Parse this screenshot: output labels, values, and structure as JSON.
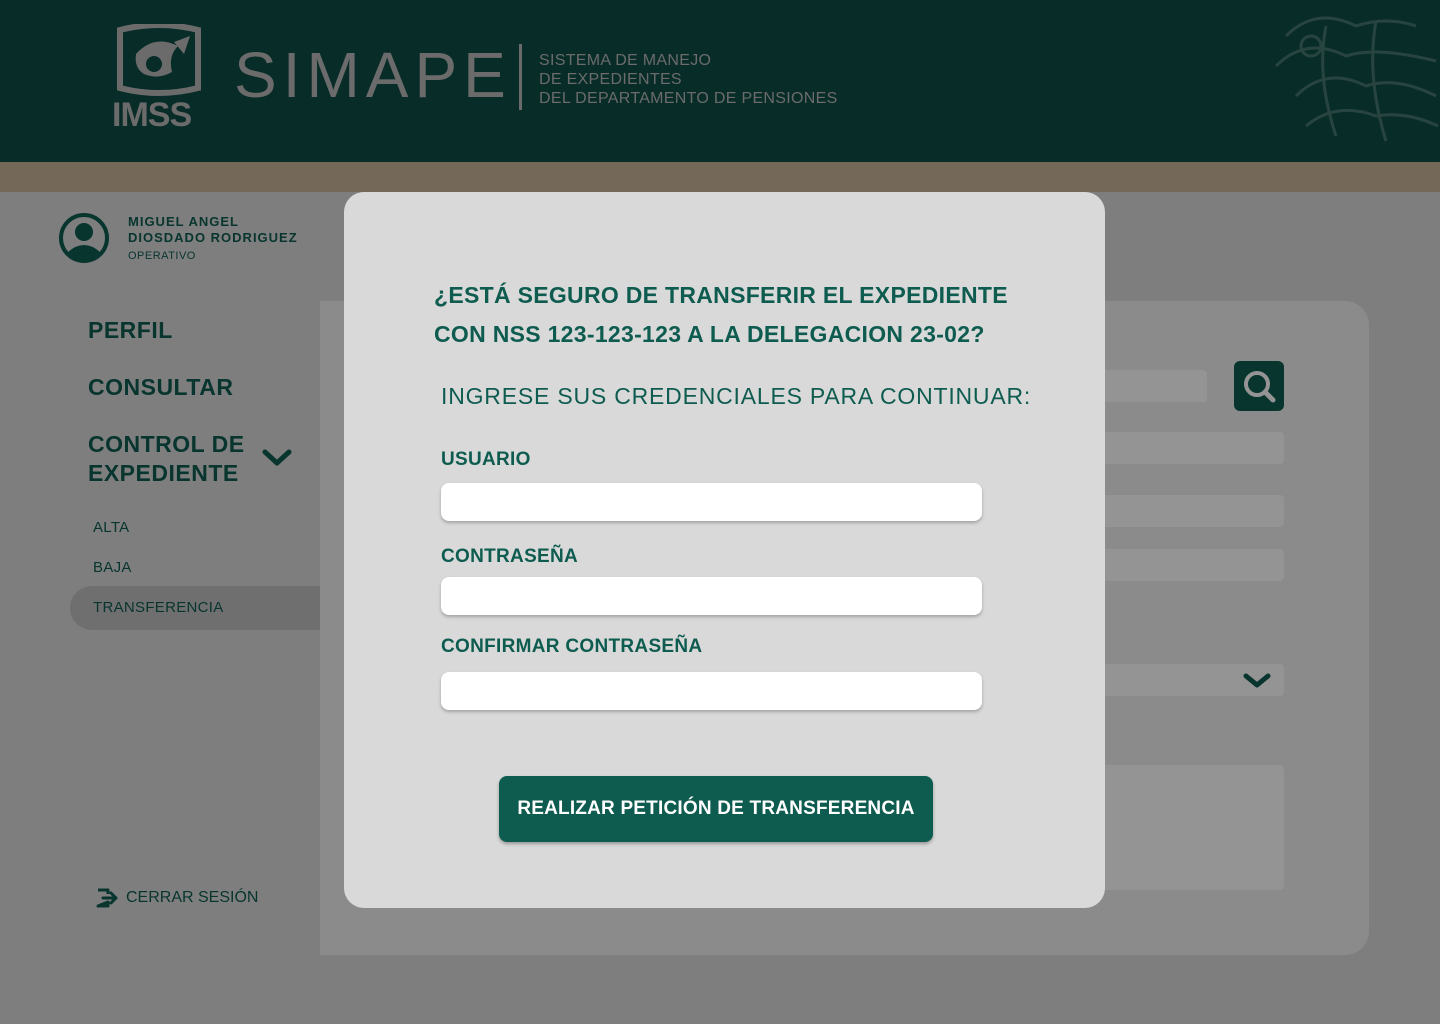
{
  "header": {
    "logo_text": "IMSS",
    "app_name": "SIMAPE",
    "subtitle_lines": [
      "SISTEMA DE MANEJO",
      "DE EXPEDIENTES",
      "DEL DEPARTAMENTO DE PENSIONES"
    ]
  },
  "user": {
    "name_line1": "MIGUEL ANGEL",
    "name_line2": "DIOSDADO RODRIGUEZ",
    "role": "OPERATIVO"
  },
  "sidebar": {
    "items": [
      {
        "label": "PERFIL"
      },
      {
        "label": "CONSULTAR"
      },
      {
        "label_line1": "CONTROL DE",
        "label_line2": "EXPEDIENTE"
      }
    ],
    "subitems": [
      {
        "label": "ALTA"
      },
      {
        "label": "BAJA"
      },
      {
        "label": "TRANSFERENCIA",
        "active": true
      }
    ],
    "logout_label": "CERRAR SESIÓN"
  },
  "modal": {
    "question_line1": "¿ESTÁ SEGURO DE TRANSFERIR EL EXPEDIENTE",
    "question_line2": "CON NSS 123-123-123 A LA DELEGACION 23-02?",
    "instruction": "INGRESE SUS CREDENCIALES PARA CONTINUAR:",
    "fields": [
      {
        "label": "USUARIO",
        "value": "",
        "placeholder": ""
      },
      {
        "label": "CONTRASEÑA",
        "value": "",
        "placeholder": ""
      },
      {
        "label": "CONFIRMAR CONTRASEÑA",
        "value": "",
        "placeholder": ""
      }
    ],
    "submit_label": "REALIZAR PETICIÓN DE TRANSFERENCIA"
  },
  "colors": {
    "primary": "#0e5c50",
    "header_bg": "#0e4d45",
    "accent_band": "#c8b59a",
    "modal_bg": "#d9d9d9"
  },
  "icons": [
    "imss-logo-icon",
    "eagle-emblem-icon",
    "user-avatar-icon",
    "chevron-down-icon",
    "search-icon",
    "logout-icon"
  ]
}
